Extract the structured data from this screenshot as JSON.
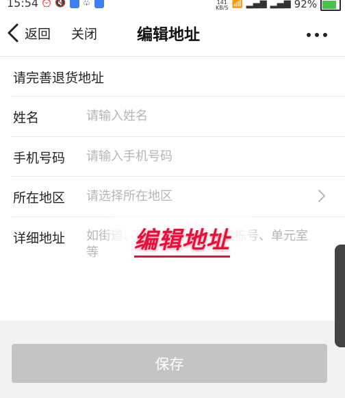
{
  "status_bar": {
    "time": "15:54",
    "net_speed_value": "141",
    "net_speed_unit": "KB/S",
    "battery": "92%",
    "battery_level": 0.92,
    "icons": [
      "alarm-icon",
      "mute-icon",
      "shield-app-icon",
      "penguin-icon",
      "shield-app-icon",
      "wifi-icon",
      "signal-icon",
      "signal-4g-icon",
      "battery-icon"
    ]
  },
  "nav": {
    "back_label": "返回",
    "close_label": "关闭",
    "title": "编辑地址"
  },
  "form": {
    "header": "请完善退货地址",
    "fields": [
      {
        "label": "姓名",
        "placeholder": "请输入姓名",
        "value": ""
      },
      {
        "label": "手机号码",
        "placeholder": "请输入手机号码",
        "value": ""
      },
      {
        "label": "所在地区",
        "placeholder": "请选择所在地区",
        "value": ""
      },
      {
        "label": "详细地址",
        "placeholder": "如街道、门牌号、小区、楼栋号、单元室等",
        "value": ""
      }
    ]
  },
  "overlay": {
    "caption": "编辑地址"
  },
  "save_button": {
    "label": "保存"
  },
  "colors": {
    "accent_red": "#e8103a",
    "button_disabled": "#c4c4c4",
    "placeholder": "#b5b5b5",
    "battery_green": "#4cc04c"
  }
}
